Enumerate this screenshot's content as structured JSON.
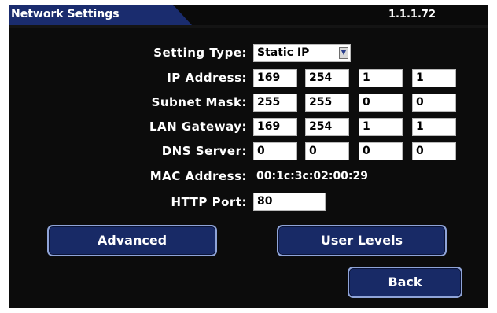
{
  "header": {
    "title": "Network Settings",
    "version": "1.1.1.72"
  },
  "form": {
    "setting_type": {
      "label": "Setting Type:",
      "value": "Static IP",
      "arrow": "▼"
    },
    "ip_address": {
      "label": "IP Address:",
      "octets": [
        "169",
        "254",
        "1",
        "1"
      ]
    },
    "subnet_mask": {
      "label": "Subnet Mask:",
      "octets": [
        "255",
        "255",
        "0",
        "0"
      ]
    },
    "lan_gateway": {
      "label": "LAN Gateway:",
      "octets": [
        "169",
        "254",
        "1",
        "1"
      ]
    },
    "dns_server": {
      "label": "DNS Server:",
      "octets": [
        "0",
        "0",
        "0",
        "0"
      ]
    },
    "mac_address": {
      "label": "MAC Address:",
      "value": "00:1c:3c:02:00:29"
    },
    "http_port": {
      "label": "HTTP Port:",
      "value": "80"
    }
  },
  "buttons": {
    "advanced": "Advanced",
    "user_levels": "User Levels",
    "back": "Back"
  },
  "colors": {
    "title_tab": "#1a2c6e",
    "button_fill": "#182a66",
    "button_border": "#8fa4d8",
    "background": "#0c0c0c"
  },
  "icons": {
    "dropdown": "chevron-down-icon"
  }
}
